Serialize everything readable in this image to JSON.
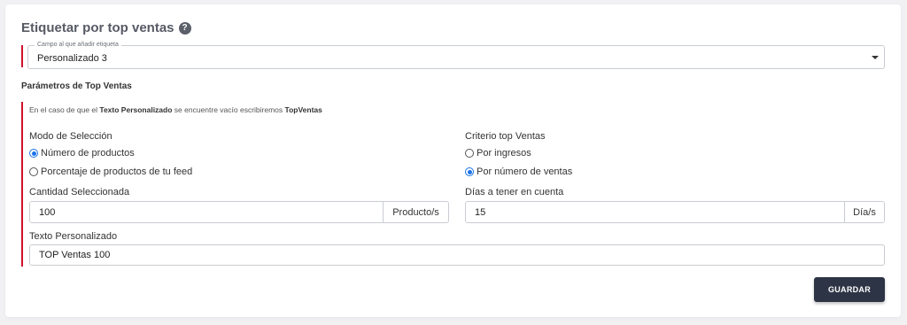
{
  "header": {
    "title": "Etiquetar por top ventas",
    "help_icon": "help-icon",
    "help_glyph": "?"
  },
  "field_select": {
    "legend": "Campo al que añadir etiqueta",
    "value": "Personalizado 3"
  },
  "params": {
    "title": "Parámetros de Top Ventas",
    "info_prefix": "En el caso de que el ",
    "info_bold1": "Texto Personalizado",
    "info_middle": " se encuentre vacío escribiremos ",
    "info_bold2": "TopVentas"
  },
  "selection_mode": {
    "label": "Modo de Selección",
    "options": [
      {
        "label": "Número de productos",
        "checked": true
      },
      {
        "label": "Porcentaje de productos de tu feed",
        "checked": false
      }
    ]
  },
  "criteria": {
    "label": "Criterio top Ventas",
    "options": [
      {
        "label": "Por ingresos",
        "checked": false
      },
      {
        "label": "Por número de ventas",
        "checked": true
      }
    ]
  },
  "quantity": {
    "label": "Cantidad Seleccionada",
    "value": "100",
    "unit": "Producto/s"
  },
  "days": {
    "label": "Días a tener en cuenta",
    "value": "15",
    "unit": "Día/s"
  },
  "custom_text": {
    "label": "Texto Personalizado",
    "value": "TOP Ventas 100"
  },
  "save_button": {
    "label": "GUARDAR"
  },
  "colors": {
    "accent_bar": "#d0112b",
    "radio_checked": "#1a73e8",
    "button_bg": "#2d3445"
  }
}
